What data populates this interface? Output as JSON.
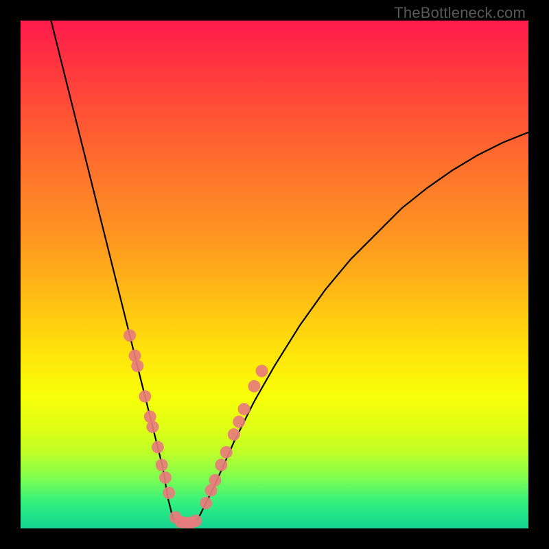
{
  "watermark": "TheBottleneck.com",
  "colors": {
    "frame": "#000000",
    "dot": "#e77c7c",
    "curve": "#000000",
    "gradient_top": "#ff1a4d",
    "gradient_bottom": "#14d492"
  },
  "chart_data": {
    "type": "line",
    "title": "",
    "xlabel": "",
    "ylabel": "",
    "xlim": [
      0,
      100
    ],
    "ylim": [
      0,
      100
    ],
    "grid": false,
    "legend": false,
    "series": [
      {
        "name": "curve-left",
        "x": [
          6,
          8,
          10,
          12,
          14,
          16,
          18,
          20,
          22,
          24,
          26,
          28,
          29,
          30
        ],
        "y": [
          100,
          92,
          84,
          76,
          68,
          60,
          52,
          44,
          36,
          28,
          20,
          12,
          6,
          2
        ]
      },
      {
        "name": "valley-floor",
        "x": [
          30,
          31,
          32,
          33,
          34,
          35
        ],
        "y": [
          2,
          1.2,
          1,
          1,
          1.2,
          2
        ]
      },
      {
        "name": "curve-right",
        "x": [
          35,
          38,
          42,
          46,
          50,
          55,
          60,
          65,
          70,
          75,
          80,
          85,
          90,
          95,
          100
        ],
        "y": [
          2,
          8,
          17,
          25,
          32,
          40,
          47,
          53,
          58,
          63,
          67,
          70.5,
          73.5,
          76,
          78
        ]
      }
    ],
    "scatter_points": {
      "name": "highlight-dots",
      "points": [
        {
          "x": 21.5,
          "y": 38
        },
        {
          "x": 22.5,
          "y": 34
        },
        {
          "x": 23.0,
          "y": 32
        },
        {
          "x": 24.5,
          "y": 26
        },
        {
          "x": 25.5,
          "y": 22
        },
        {
          "x": 26.0,
          "y": 20
        },
        {
          "x": 27.0,
          "y": 16
        },
        {
          "x": 27.8,
          "y": 12.5
        },
        {
          "x": 28.5,
          "y": 10
        },
        {
          "x": 29.2,
          "y": 7
        },
        {
          "x": 30.5,
          "y": 2.2
        },
        {
          "x": 31.5,
          "y": 1.3
        },
        {
          "x": 32.5,
          "y": 1.1
        },
        {
          "x": 33.5,
          "y": 1.1
        },
        {
          "x": 34.5,
          "y": 1.5
        },
        {
          "x": 36.5,
          "y": 5
        },
        {
          "x": 37.5,
          "y": 7.5
        },
        {
          "x": 38.3,
          "y": 9.5
        },
        {
          "x": 39.5,
          "y": 12.5
        },
        {
          "x": 40.5,
          "y": 15
        },
        {
          "x": 42.0,
          "y": 18.5
        },
        {
          "x": 43.0,
          "y": 21
        },
        {
          "x": 44.0,
          "y": 23.5
        },
        {
          "x": 46.0,
          "y": 28
        },
        {
          "x": 47.5,
          "y": 31
        }
      ]
    }
  }
}
